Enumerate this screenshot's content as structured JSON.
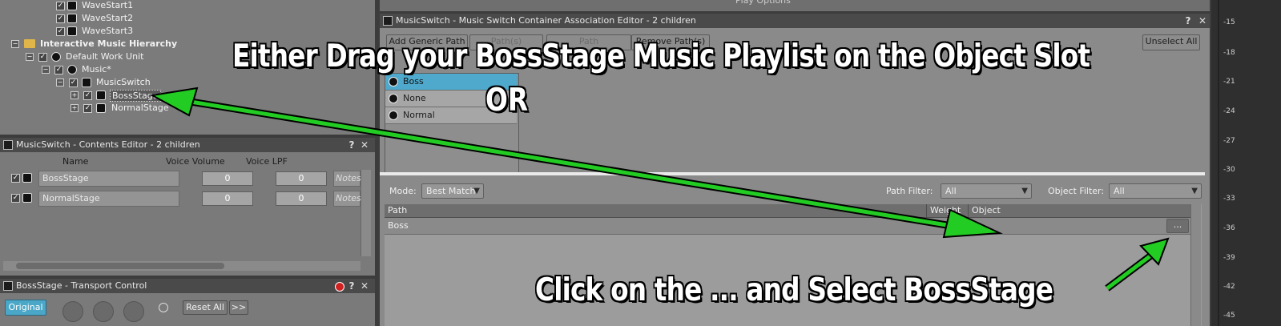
{
  "hierarchy": {
    "items": [
      {
        "label": "WaveStart1"
      },
      {
        "label": "WaveStart2"
      },
      {
        "label": "WaveStart3"
      },
      {
        "label": "Interactive Music Hierarchy"
      },
      {
        "label": "Default Work Unit"
      },
      {
        "label": "Music*"
      },
      {
        "label": "MusicSwitch"
      },
      {
        "label": "BossStage"
      },
      {
        "label": "NormalStage"
      }
    ]
  },
  "contents_editor": {
    "title": "MusicSwitch - Contents Editor - 2 children",
    "help": "?",
    "close": "✕",
    "columns": {
      "name": "Name",
      "voice_volume": "Voice Volume",
      "voice_lpf": "Voice LPF"
    },
    "rows": [
      {
        "name": "BossStage",
        "volume": "0",
        "lpf": "0",
        "notes": "Notes"
      },
      {
        "name": "NormalStage",
        "volume": "0",
        "lpf": "0",
        "notes": "Notes"
      }
    ]
  },
  "transport": {
    "title": "BossStage - Transport Control",
    "original_label": "Original",
    "reset_all": "Reset All",
    "more": ">>",
    "help": "?",
    "close": "✕"
  },
  "association_editor": {
    "title": "MusicSwitch - Music Switch Container Association Editor - 2 children",
    "help": "?",
    "close": "✕",
    "play_options": "Play Options",
    "buttons": {
      "add_generic_path": "Add Generic Path",
      "btn2": "Path(s)",
      "btn3": "Path",
      "remove": "Remove Path(s)",
      "unselect_all": "Unselect All"
    },
    "switch_values": [
      {
        "label": "Boss",
        "selected": true
      },
      {
        "label": "None",
        "selected": false
      },
      {
        "label": "NormalStage_hidden",
        "display": "Normal",
        "selected": false
      }
    ],
    "mode_label": "Mode:",
    "mode_value": "Best Match",
    "path_filter_label": "Path Filter:",
    "path_filter_value": "All",
    "object_filter_label": "Object Filter:",
    "object_filter_value": "All",
    "table": {
      "columns": {
        "path": "Path",
        "weight": "Weight",
        "object": "Object"
      },
      "rows": [
        {
          "path": "Boss",
          "weight": "",
          "object": "",
          "browse": "..."
        }
      ]
    }
  },
  "meter": {
    "ticks": [
      "-15",
      "-18",
      "-21",
      "-24",
      "-27",
      "-30",
      "-33",
      "-36",
      "-39",
      "-42",
      "-45"
    ]
  },
  "annotations": {
    "line1": "Either Drag your BossStage Music Playlist on the Object Slot",
    "line2": "OR",
    "line3": "Click on the ... and Select BossStage",
    "arrow_color": "#22cc22"
  }
}
